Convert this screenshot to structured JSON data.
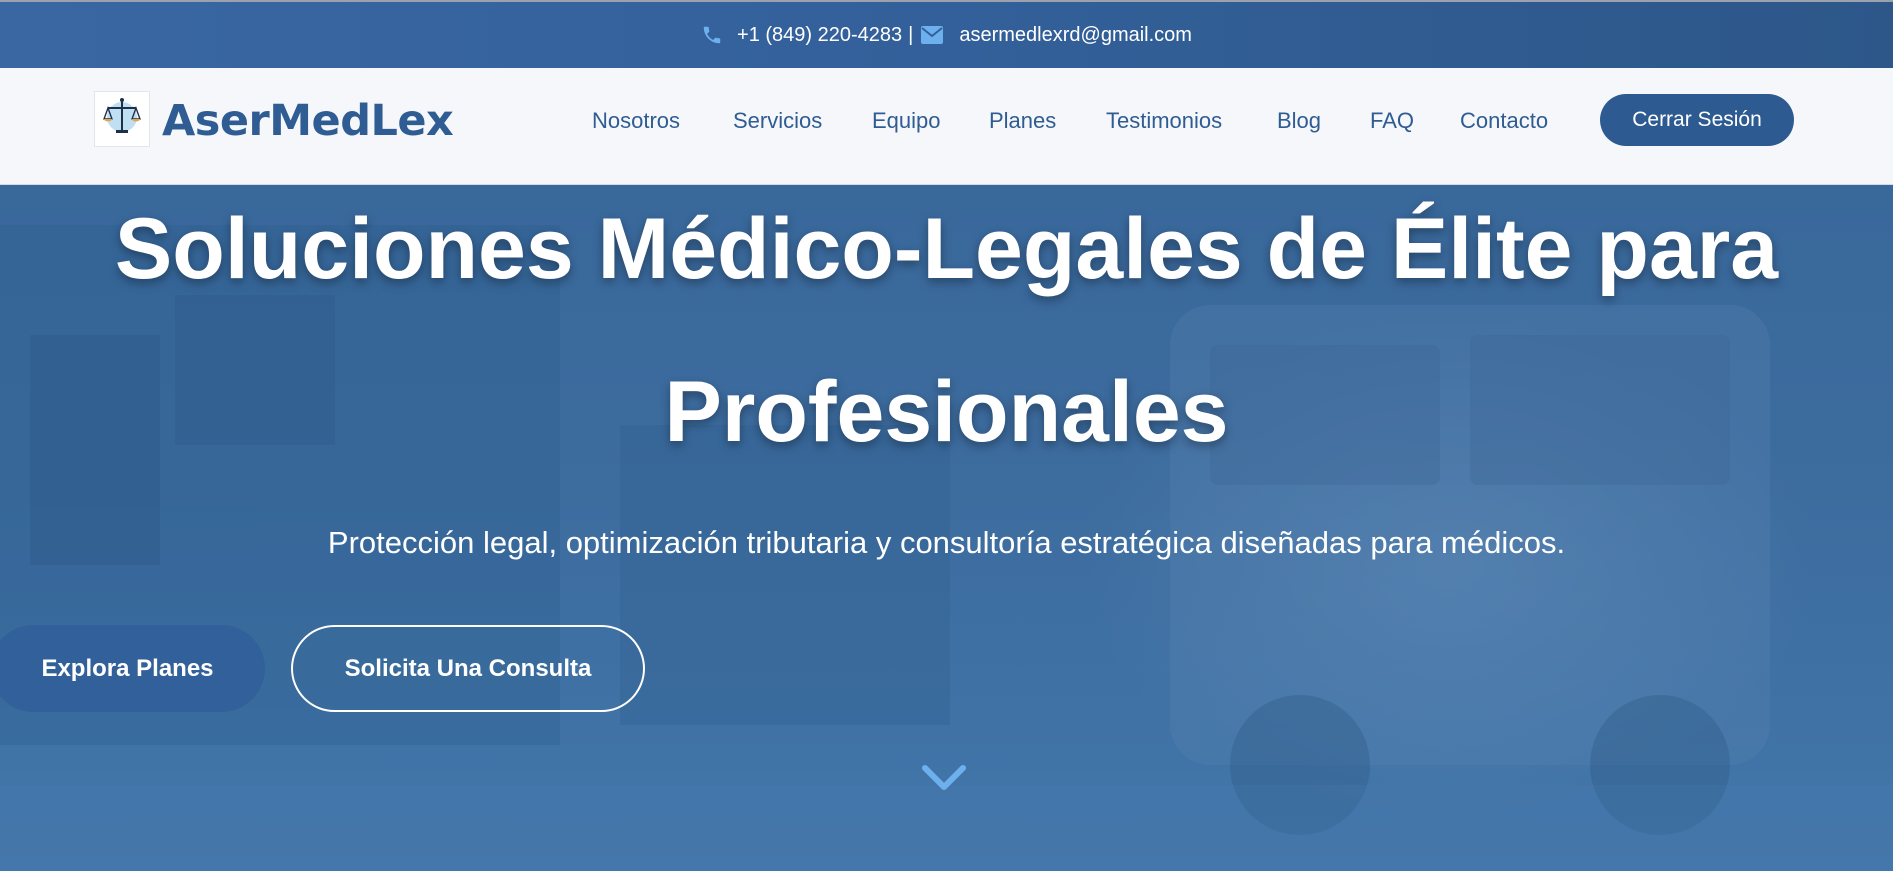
{
  "topbar": {
    "phone": "+1 (849) 220-4283",
    "separator": "|",
    "email": "asermedlexrd@gmail.com",
    "phone_icon": "phone-icon",
    "email_icon": "envelope-icon"
  },
  "nav": {
    "brand": "AserMedLex",
    "logo_icon": "scales-of-justice-logo",
    "logo_text": "ASERMEDLEX",
    "links": [
      "Nosotros",
      "Servicios",
      "Equipo",
      "Planes",
      "Testimonios",
      "Blog",
      "FAQ",
      "Contacto"
    ],
    "logout_label": "Cerrar Sesión"
  },
  "hero": {
    "title_line1": "Soluciones Médico-Legales de Élite para",
    "title_line2": "Profesionales",
    "subtitle": "Protección legal, optimización tributaria y consultoría estratégica diseñadas para médicos.",
    "primary_button": "Explora Planes",
    "secondary_button": "Solicita Una Consulta",
    "scroll_icon": "chevron-down-icon"
  },
  "colors": {
    "topbar_bg": "#33609a",
    "nav_bg": "#f5f7fa",
    "brand": "#2f5c93",
    "accent_icon": "#6cb0ee",
    "hero_bg": "#3d6c9f",
    "button_primary": "#32609a",
    "text_light": "#ffffff"
  }
}
